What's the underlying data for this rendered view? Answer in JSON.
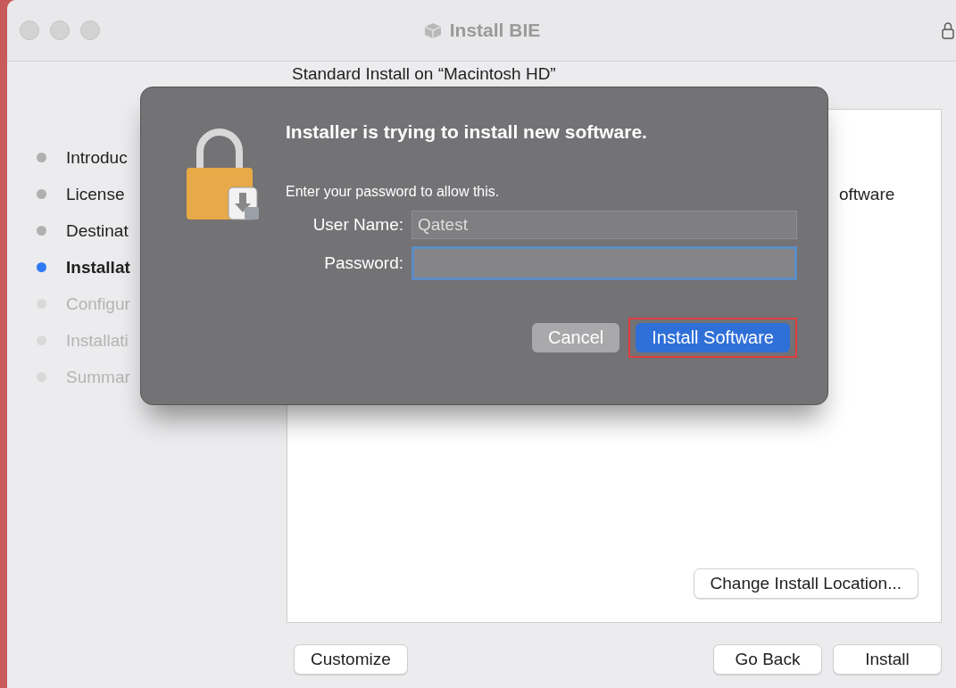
{
  "window": {
    "title": "Install BIE"
  },
  "subtitle": "Standard Install on “Macintosh HD”",
  "sidebar": {
    "items": [
      {
        "label": "Introduc",
        "selected": false,
        "disabled": false
      },
      {
        "label": "License",
        "selected": false,
        "disabled": false
      },
      {
        "label": "Destinat",
        "selected": false,
        "disabled": false
      },
      {
        "label": "Installat",
        "selected": true,
        "disabled": false
      },
      {
        "label": "Configur",
        "selected": false,
        "disabled": true
      },
      {
        "label": "Installati",
        "selected": false,
        "disabled": true
      },
      {
        "label": "Summar",
        "selected": false,
        "disabled": true
      }
    ]
  },
  "panel": {
    "text": "oftware",
    "button": "Change Install Location..."
  },
  "buttons": {
    "left": "Customize",
    "right": [
      "Go Back",
      "Install"
    ]
  },
  "dialog": {
    "title": "Installer is trying to install new software.",
    "message": "Enter your password to allow this.",
    "fields": [
      {
        "label": "User Name:",
        "value": "Qatest",
        "focused": false
      },
      {
        "label": "Password:",
        "focused": true
      }
    ],
    "buttons": [
      {
        "label": "Cancel",
        "kind": "secondary",
        "highlighted": false
      },
      {
        "label": "Install Software",
        "kind": "primary",
        "highlighted": true
      }
    ]
  }
}
